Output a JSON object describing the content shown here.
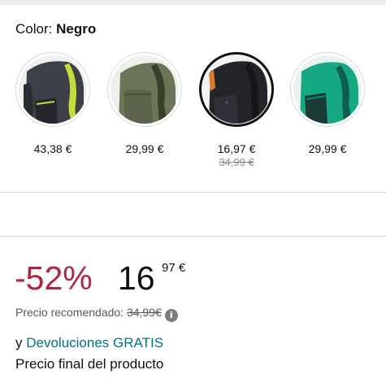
{
  "color_selector": {
    "label": "Color:",
    "selected": "Negro"
  },
  "variants": [
    {
      "price": "43,38 €",
      "strike_price": "",
      "icon": "backpack-gray-yellow",
      "main_color": "#3d4048",
      "accent_color": "#c6dc3a"
    },
    {
      "price": "29,99 €",
      "strike_price": "",
      "icon": "backpack-olive-green",
      "main_color": "#6b7558",
      "accent_color": "#3a3f2c"
    },
    {
      "price": "16,97 €",
      "strike_price": "34,99 €",
      "icon": "backpack-black",
      "main_color": "#23242a",
      "accent_color": "#d97c2a",
      "selected": true
    },
    {
      "price": "29,99 €",
      "strike_price": "",
      "icon": "backpack-teal",
      "main_color": "#16a883",
      "accent_color": "#0c5f4f"
    }
  ],
  "pricing": {
    "discount": "-52%",
    "price_whole": "16",
    "price_fraction": "97 €",
    "recommended_label": "Precio recomendado:",
    "recommended_price": "34,99€"
  },
  "returns": {
    "prefix": "y",
    "link_text": "Devoluciones GRATIS"
  },
  "final_price_label": "Precio final del producto",
  "colors": {
    "discount": "#b12742",
    "link": "#007185",
    "divider": "#d5d9d9"
  }
}
